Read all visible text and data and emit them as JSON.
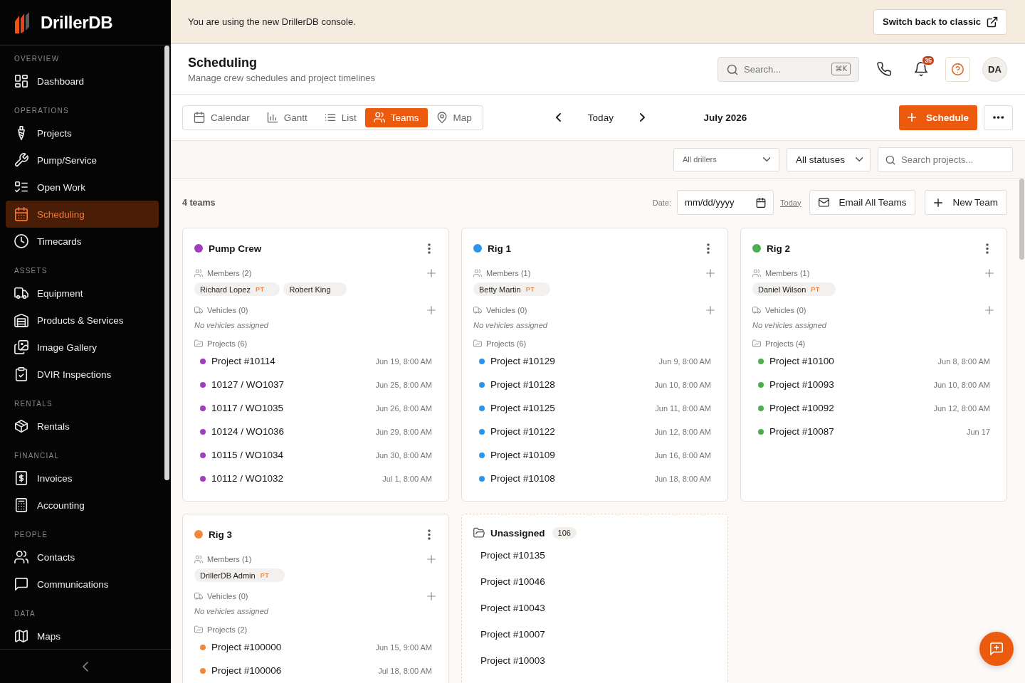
{
  "sidebar": {
    "brand": "DrillerDB",
    "sections": [
      {
        "heading": "OVERVIEW",
        "items": [
          {
            "label": "Dashboard",
            "selected": false
          }
        ]
      },
      {
        "heading": "OPERATIONS",
        "items": [
          {
            "label": "Projects",
            "selected": false
          },
          {
            "label": "Pump/Service",
            "selected": false
          },
          {
            "label": "Open Work",
            "selected": false
          },
          {
            "label": "Scheduling",
            "selected": true
          },
          {
            "label": "Timecards",
            "selected": false
          }
        ]
      },
      {
        "heading": "ASSETS",
        "items": [
          {
            "label": "Equipment",
            "selected": false
          },
          {
            "label": "Products & Services",
            "selected": false
          },
          {
            "label": "Image Gallery",
            "selected": false
          },
          {
            "label": "DVIR Inspections",
            "selected": false
          }
        ]
      },
      {
        "heading": "RENTALS",
        "items": [
          {
            "label": "Rentals",
            "selected": false
          }
        ]
      },
      {
        "heading": "FINANCIAL",
        "items": [
          {
            "label": "Invoices",
            "selected": false
          },
          {
            "label": "Accounting",
            "selected": false
          }
        ]
      },
      {
        "heading": "PEOPLE",
        "items": [
          {
            "label": "Contacts",
            "selected": false
          },
          {
            "label": "Communications",
            "selected": false
          }
        ]
      },
      {
        "heading": "DATA",
        "items": [
          {
            "label": "Maps",
            "selected": false
          }
        ]
      }
    ]
  },
  "banner": {
    "message": "You are using the new DrillerDB console.",
    "button": "Switch back to classic"
  },
  "header": {
    "title": "Scheduling",
    "subtitle": "Manage crew schedules and project timelines",
    "search": {
      "placeholder": "Search...",
      "shortcut": "⌘K"
    },
    "notification_count": "35",
    "avatar": "DA"
  },
  "toolbar": {
    "views": [
      {
        "label": "Calendar",
        "selected": false
      },
      {
        "label": "Gantt",
        "selected": false
      },
      {
        "label": "List",
        "selected": false
      },
      {
        "label": "Teams",
        "selected": true
      },
      {
        "label": "Map",
        "selected": false
      }
    ],
    "today": "Today",
    "period": "July 2026",
    "schedule_button": "Schedule"
  },
  "filters": {
    "driller": "All drillers",
    "status": "All statuses",
    "search": {
      "placeholder": "Search projects..."
    }
  },
  "teams_bar": {
    "count": "4 teams",
    "date_label": "Date:",
    "date_value": "mm/dd/yyyy",
    "today_link": "Today",
    "email_button": "Email All Teams",
    "new_button": "New Team"
  },
  "teams": [
    {
      "name": "Pump Crew",
      "color": "#a23dbd",
      "members_label": "Members (2)",
      "members": [
        {
          "name": "Richard Lopez",
          "tag": "PT"
        },
        {
          "name": "Robert King"
        }
      ],
      "vehicles_label": "Vehicles (0)",
      "vehicles_note": "No vehicles assigned",
      "projects_label": "Projects (6)",
      "projects": [
        {
          "name": "Project #10114",
          "date": "Jun 19, 8:00 AM"
        },
        {
          "name": "10127 / WO1037",
          "date": "Jun 25, 8:00 AM"
        },
        {
          "name": "10117 / WO1035",
          "date": "Jun 26, 8:00 AM"
        },
        {
          "name": "10124 / WO1036",
          "date": "Jun 29, 8:00 AM"
        },
        {
          "name": "10115 / WO1034",
          "date": "Jun 30, 8:00 AM"
        },
        {
          "name": "10112 / WO1032",
          "date": "Jul 1, 8:00 AM"
        }
      ]
    },
    {
      "name": "Rig 1",
      "color": "#2e95ee",
      "members_label": "Members (1)",
      "members": [
        {
          "name": "Betty Martin",
          "tag": "PT"
        }
      ],
      "vehicles_label": "Vehicles (0)",
      "vehicles_note": "No vehicles assigned",
      "projects_label": "Projects (6)",
      "projects": [
        {
          "name": "Project #10129",
          "date": "Jun 9, 8:00 AM"
        },
        {
          "name": "Project #10128",
          "date": "Jun 10, 8:00 AM"
        },
        {
          "name": "Project #10125",
          "date": "Jun 11, 8:00 AM"
        },
        {
          "name": "Project #10122",
          "date": "Jun 12, 8:00 AM"
        },
        {
          "name": "Project #10109",
          "date": "Jun 16, 8:00 AM"
        },
        {
          "name": "Project #10108",
          "date": "Jun 18, 8:00 AM"
        }
      ]
    },
    {
      "name": "Rig 2",
      "color": "#4caf50",
      "members_label": "Members (1)",
      "members": [
        {
          "name": "Daniel Wilson",
          "tag": "PT"
        }
      ],
      "vehicles_label": "Vehicles (0)",
      "vehicles_note": "No vehicles assigned",
      "projects_label": "Projects (4)",
      "projects": [
        {
          "name": "Project #10100",
          "date": "Jun 8, 8:00 AM"
        },
        {
          "name": "Project #10093",
          "date": "Jun 10, 8:00 AM"
        },
        {
          "name": "Project #10092",
          "date": "Jun 12, 8:00 AM"
        },
        {
          "name": "Project #10087",
          "date": "Jun 17"
        }
      ]
    },
    {
      "name": "Rig 3",
      "color": "#f2883a",
      "members_label": "Members (1)",
      "members": [
        {
          "name": "DrillerDB Admin",
          "tag": "PT"
        }
      ],
      "vehicles_label": "Vehicles (0)",
      "vehicles_note": "No vehicles assigned",
      "projects_label": "Projects (2)",
      "projects": [
        {
          "name": "Project #100000",
          "date": "Jun 15, 9:00 AM"
        },
        {
          "name": "Project #100006",
          "date": "Jul 18, 8:00 AM"
        }
      ]
    }
  ],
  "unassigned": {
    "title": "Unassigned",
    "count": "106",
    "projects": [
      "Project #10135",
      "Project #10046",
      "Project #10043",
      "Project #10007",
      "Project #10003"
    ]
  }
}
